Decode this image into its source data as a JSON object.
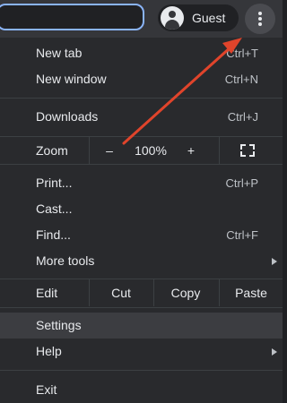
{
  "toolbar": {
    "profile_label": "Guest"
  },
  "menu": {
    "new_tab": {
      "label": "New tab",
      "shortcut": "Ctrl+T"
    },
    "new_window": {
      "label": "New window",
      "shortcut": "Ctrl+N"
    },
    "downloads": {
      "label": "Downloads",
      "shortcut": "Ctrl+J"
    },
    "zoom": {
      "label": "Zoom",
      "decrease": "–",
      "level": "100%",
      "increase": "+"
    },
    "print": {
      "label": "Print...",
      "shortcut": "Ctrl+P"
    },
    "cast": {
      "label": "Cast..."
    },
    "find": {
      "label": "Find...",
      "shortcut": "Ctrl+F"
    },
    "more_tools": {
      "label": "More tools"
    },
    "edit": {
      "label": "Edit",
      "cut": "Cut",
      "copy": "Copy",
      "paste": "Paste"
    },
    "settings": {
      "label": "Settings"
    },
    "help": {
      "label": "Help"
    },
    "exit": {
      "label": "Exit"
    }
  },
  "colors": {
    "menu_background": "#292a2d",
    "highlight_row": "#3c3d41",
    "annotation_arrow": "#e0442b",
    "omnibox_focus": "#8ab4f8"
  }
}
